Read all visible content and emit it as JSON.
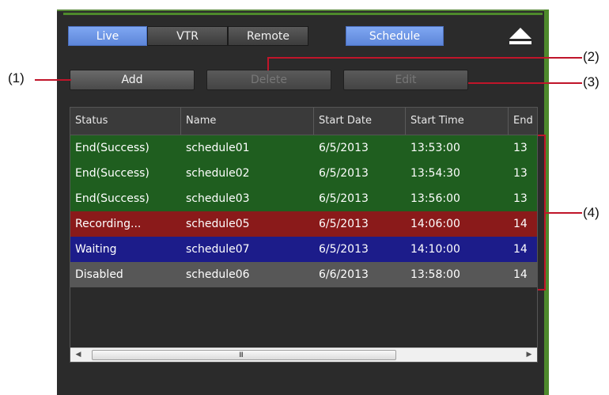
{
  "modes": {
    "live": "Live",
    "vtr": "VTR",
    "remote": "Remote",
    "schedule": "Schedule"
  },
  "actions": {
    "add": "Add",
    "delete": "Delete",
    "edit": "Edit"
  },
  "table": {
    "headers": [
      "Status",
      "Name",
      "Start Date",
      "Start Time",
      "End"
    ],
    "rows": [
      {
        "status": "End(Success)",
        "name": "schedule01",
        "date": "6/5/2013",
        "time": "13:53:00",
        "end": "13",
        "color": "#1f5e1f"
      },
      {
        "status": "End(Success)",
        "name": "schedule02",
        "date": "6/5/2013",
        "time": "13:54:30",
        "end": "13",
        "color": "#1f5e1f"
      },
      {
        "status": "End(Success)",
        "name": "schedule03",
        "date": "6/5/2013",
        "time": "13:56:00",
        "end": "13",
        "color": "#1f5e1f"
      },
      {
        "status": "Recording...",
        "name": "schedule05",
        "date": "6/5/2013",
        "time": "14:06:00",
        "end": "14",
        "color": "#8a1a1a"
      },
      {
        "status": "Waiting",
        "name": "schedule07",
        "date": "6/5/2013",
        "time": "14:10:00",
        "end": "14",
        "color": "#1c1c8a"
      },
      {
        "status": "Disabled",
        "name": "schedule06",
        "date": "6/6/2013",
        "time": "13:58:00",
        "end": "14",
        "color": "#575757"
      }
    ],
    "scroll_grip": "III"
  },
  "callouts": {
    "c1": "(1)",
    "c2": "(2)",
    "c3": "(3)",
    "c4": "(4)"
  },
  "colors": {
    "accent_green": "#4e8a2c",
    "callout_red": "#c0152a",
    "selected_blue": "#6d96e6"
  }
}
